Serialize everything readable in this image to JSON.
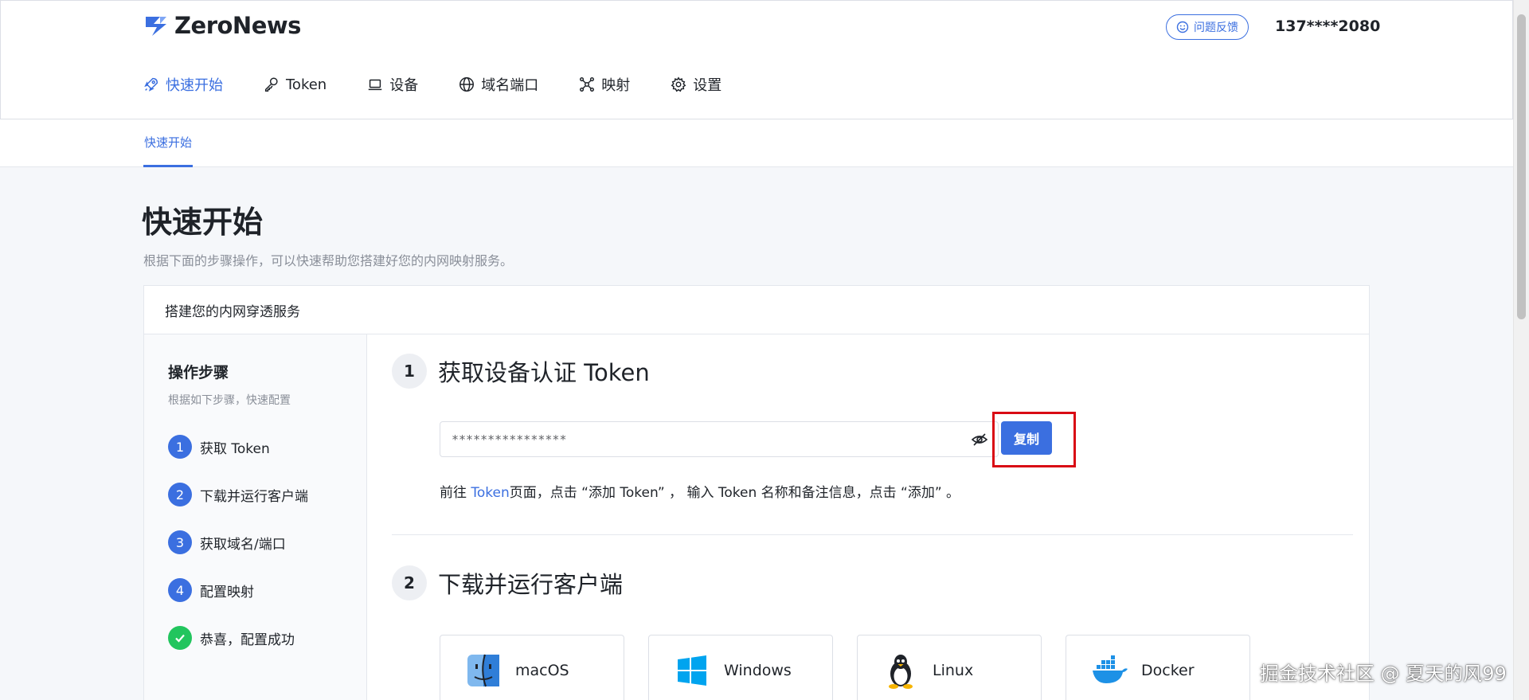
{
  "header": {
    "logo_text": "ZeroNews",
    "feedback_label": "问题反馈",
    "user_phone": "137****2080",
    "nav": [
      {
        "label": "快速开始",
        "icon": "rocket-icon",
        "active": true
      },
      {
        "label": "Token",
        "icon": "key-icon",
        "active": false
      },
      {
        "label": "设备",
        "icon": "laptop-icon",
        "active": false
      },
      {
        "label": "域名端口",
        "icon": "globe-icon",
        "active": false
      },
      {
        "label": "映射",
        "icon": "network-icon",
        "active": false
      },
      {
        "label": "设置",
        "icon": "gear-icon",
        "active": false
      }
    ]
  },
  "tabbar": {
    "tab_label": "快速开始"
  },
  "page": {
    "title": "快速开始",
    "subtitle": "根据下面的步骤操作，可以快速帮助您搭建好您的内网映射服务。"
  },
  "card": {
    "title": "搭建您的内网穿透服务",
    "steps": {
      "title": "操作步骤",
      "subtitle": "根据如下步骤，快速配置",
      "items": [
        {
          "num": "1",
          "label": "获取 Token"
        },
        {
          "num": "2",
          "label": "下载并运行客户端"
        },
        {
          "num": "3",
          "label": "获取域名/端口"
        },
        {
          "num": "4",
          "label": "配置映射"
        },
        {
          "num": "",
          "label": "恭喜，配置成功"
        }
      ]
    },
    "section1": {
      "num": "1",
      "title": "获取设备认证 Token",
      "token_value": "****************",
      "copy_label": "复制",
      "hint_prefix": "前往 ",
      "hint_link": "Token",
      "hint_suffix": "页面，点击 “添加 Token” ， 输入 Token 名称和备注信息，点击 “添加” 。"
    },
    "section2": {
      "num": "2",
      "title": "下载并运行客户端",
      "os": [
        {
          "label": "macOS",
          "icon": "macos-finder-icon"
        },
        {
          "label": "Windows",
          "icon": "windows-icon"
        },
        {
          "label": "Linux",
          "icon": "linux-tux-icon"
        },
        {
          "label": "Docker",
          "icon": "docker-icon"
        }
      ]
    }
  },
  "watermark": "掘金技术社区 @ 夏天的风99",
  "colors": {
    "accent": "#3b6fe0",
    "success": "#22c55e",
    "highlight": "#d90a14"
  }
}
